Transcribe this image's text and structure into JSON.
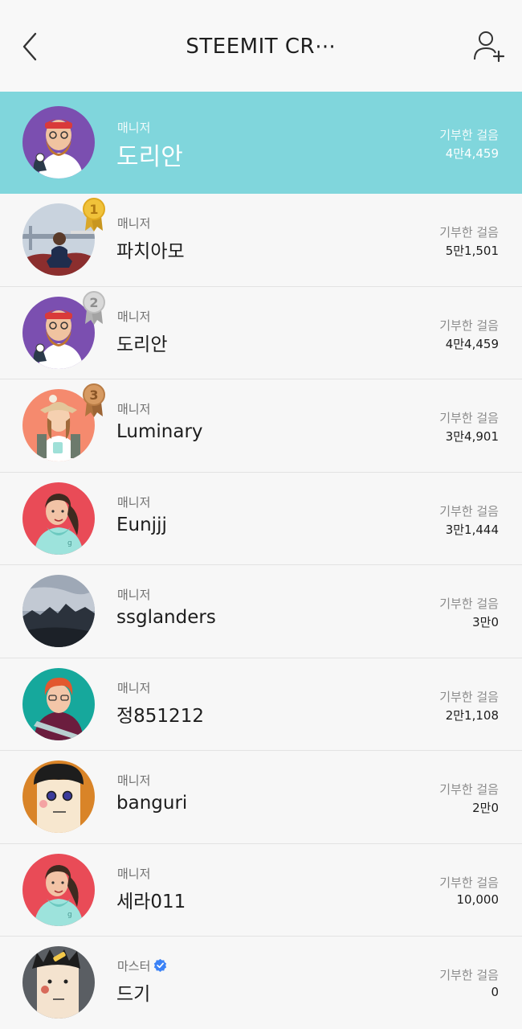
{
  "header": {
    "title": "STEEMIT CR⋯",
    "back_icon": "chevron-left-icon",
    "add_icon": "add-user-icon"
  },
  "colors": {
    "highlight": "#80d6dc",
    "gold": "#f0c23a",
    "silver": "#c9c9c9",
    "bronze": "#c98a52",
    "verified": "#3b82f6"
  },
  "me": {
    "role": "매니저",
    "name": "도리안",
    "stat_label": "기부한 걸음",
    "stat_value": "4만4,459"
  },
  "members": [
    {
      "rank": "1",
      "role": "매니저",
      "name": "파치아모",
      "stat_label": "기부한 걸음",
      "stat_value": "5만1,501"
    },
    {
      "rank": "2",
      "role": "매니저",
      "name": "도리안",
      "stat_label": "기부한 걸음",
      "stat_value": "4만4,459"
    },
    {
      "rank": "3",
      "role": "매니저",
      "name": "Luminary",
      "stat_label": "기부한 걸음",
      "stat_value": "3만4,901"
    },
    {
      "role": "매니저",
      "name": "Eunjjj",
      "stat_label": "기부한 걸음",
      "stat_value": "3만1,444"
    },
    {
      "role": "매니저",
      "name": "ssglanders",
      "stat_label": "기부한 걸음",
      "stat_value": "3만0"
    },
    {
      "role": "매니저",
      "name": "정851212",
      "stat_label": "기부한 걸음",
      "stat_value": "2만1,108"
    },
    {
      "role": "매니저",
      "name": "banguri",
      "stat_label": "기부한 걸음",
      "stat_value": "2만0"
    },
    {
      "role": "매니저",
      "name": "세라011",
      "stat_label": "기부한 걸음",
      "stat_value": "10,000"
    },
    {
      "role": "마스터",
      "name": "드기",
      "stat_label": "기부한 걸음",
      "stat_value": "0"
    }
  ]
}
